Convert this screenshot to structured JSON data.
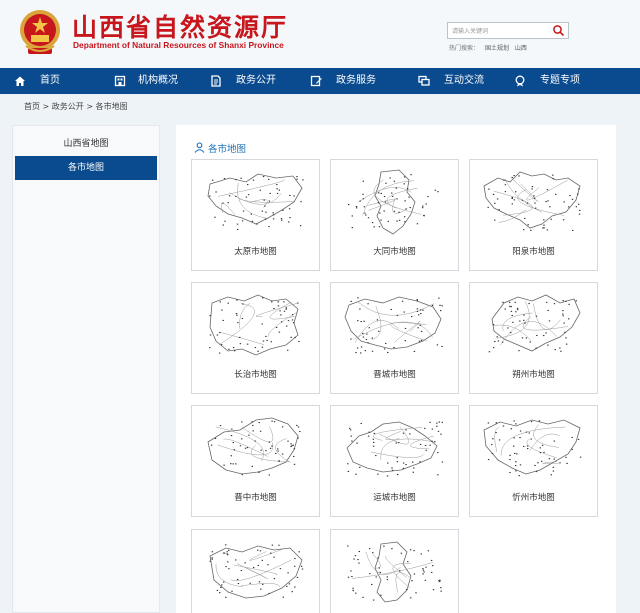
{
  "header": {
    "title_cn": "山西省自然资源厅",
    "title_en": "Department of Natural Resources of Shanxi Province",
    "search_placeholder": "请输入关键词",
    "hot_words_label": "热门搜索：",
    "hot_words": [
      "国土规划",
      "山西"
    ]
  },
  "nav": {
    "items": [
      {
        "label": "首页",
        "icon": "home-icon"
      },
      {
        "label": "机构概况",
        "icon": "building-icon"
      },
      {
        "label": "政务公开",
        "icon": "document-icon"
      },
      {
        "label": "政务服务",
        "icon": "edit-icon"
      },
      {
        "label": "互动交流",
        "icon": "chat-icon"
      },
      {
        "label": "专题专项",
        "icon": "topic-icon"
      }
    ]
  },
  "breadcrumb": "首页 > 政务公开 > 各市地图",
  "sidebar": {
    "items": [
      {
        "label": "山西省地图",
        "active": false
      },
      {
        "label": "各市地图",
        "active": true
      }
    ]
  },
  "main": {
    "section_title": "各市地图",
    "maps": [
      {
        "label": "太原市地图"
      },
      {
        "label": "大同市地图"
      },
      {
        "label": "阳泉市地图"
      },
      {
        "label": "长治市地图"
      },
      {
        "label": "晋城市地图"
      },
      {
        "label": "朔州市地图"
      },
      {
        "label": "晋中市地图"
      },
      {
        "label": "运城市地图"
      },
      {
        "label": "忻州市地图"
      },
      {
        "label": ""
      },
      {
        "label": ""
      }
    ]
  },
  "colors": {
    "brand_red": "#c8161d",
    "nav_blue": "#0a4a8e",
    "link_blue": "#1d72b8"
  }
}
